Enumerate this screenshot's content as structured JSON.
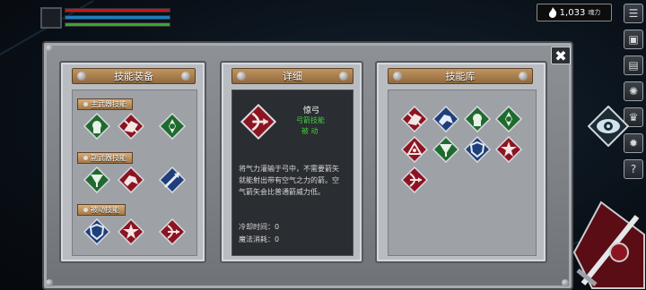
{
  "hud": {
    "power_value": "1,033",
    "power_unit": "魂力",
    "hp_fraction": 1.0,
    "mp_fraction": 1.0,
    "stamina_fraction": 1.0,
    "hp_color": "#c8141b",
    "mp_color": "#1b7fc4",
    "stamina_color": "#3aa532",
    "power_icon": "flame-icon"
  },
  "side_menu": [
    {
      "icon": "menu-list-icon",
      "glyph": "☰"
    },
    {
      "icon": "bag-icon",
      "glyph": "▣"
    },
    {
      "icon": "book-icon",
      "glyph": "▤"
    },
    {
      "icon": "gear-wheel-icon",
      "glyph": "✺"
    },
    {
      "icon": "crown-icon",
      "glyph": "♛"
    },
    {
      "icon": "settings-icon",
      "glyph": "✹"
    },
    {
      "icon": "help-icon",
      "glyph": "?"
    }
  ],
  "close_label": "✖",
  "panels": {
    "equip": {
      "title": "技能装备",
      "groups": [
        {
          "label": "主武器技能",
          "skills": [
            "green-fist-skill",
            "red-slash-skill",
            "green-whirl-skill"
          ]
        },
        {
          "label": "副武器技能",
          "skills": [
            "green-crossbow-skill",
            "red-dash-skill",
            "blue-arrow-skill"
          ]
        },
        {
          "label": "被动技能",
          "skills": [
            "blue-shield-skill",
            "red-burst-skill",
            "red-bow-skill"
          ]
        }
      ]
    },
    "detail": {
      "title": "详细",
      "skill_icon": "red-bow-skill",
      "skill_name": "惊弓",
      "skill_type": "弓箭技能",
      "skill_kind": "被 动",
      "desc": "将气力灌输于弓中，不需要箭矢就能射出带有空气之力的箭。空气箭矢会比普通箭威力低。",
      "cooldown": "冷却时间：0",
      "mana_cost": "魔法消耗：0"
    },
    "library": {
      "title": "技能库",
      "skills": [
        "red-slash-skill",
        "blue-dash-skill",
        "green-fist-skill",
        "green-whirl-skill",
        "red-spin-skill",
        "green-crossbow-skill",
        "blue-shield-skill",
        "red-burst-skill",
        "red-bow-skill"
      ]
    }
  }
}
